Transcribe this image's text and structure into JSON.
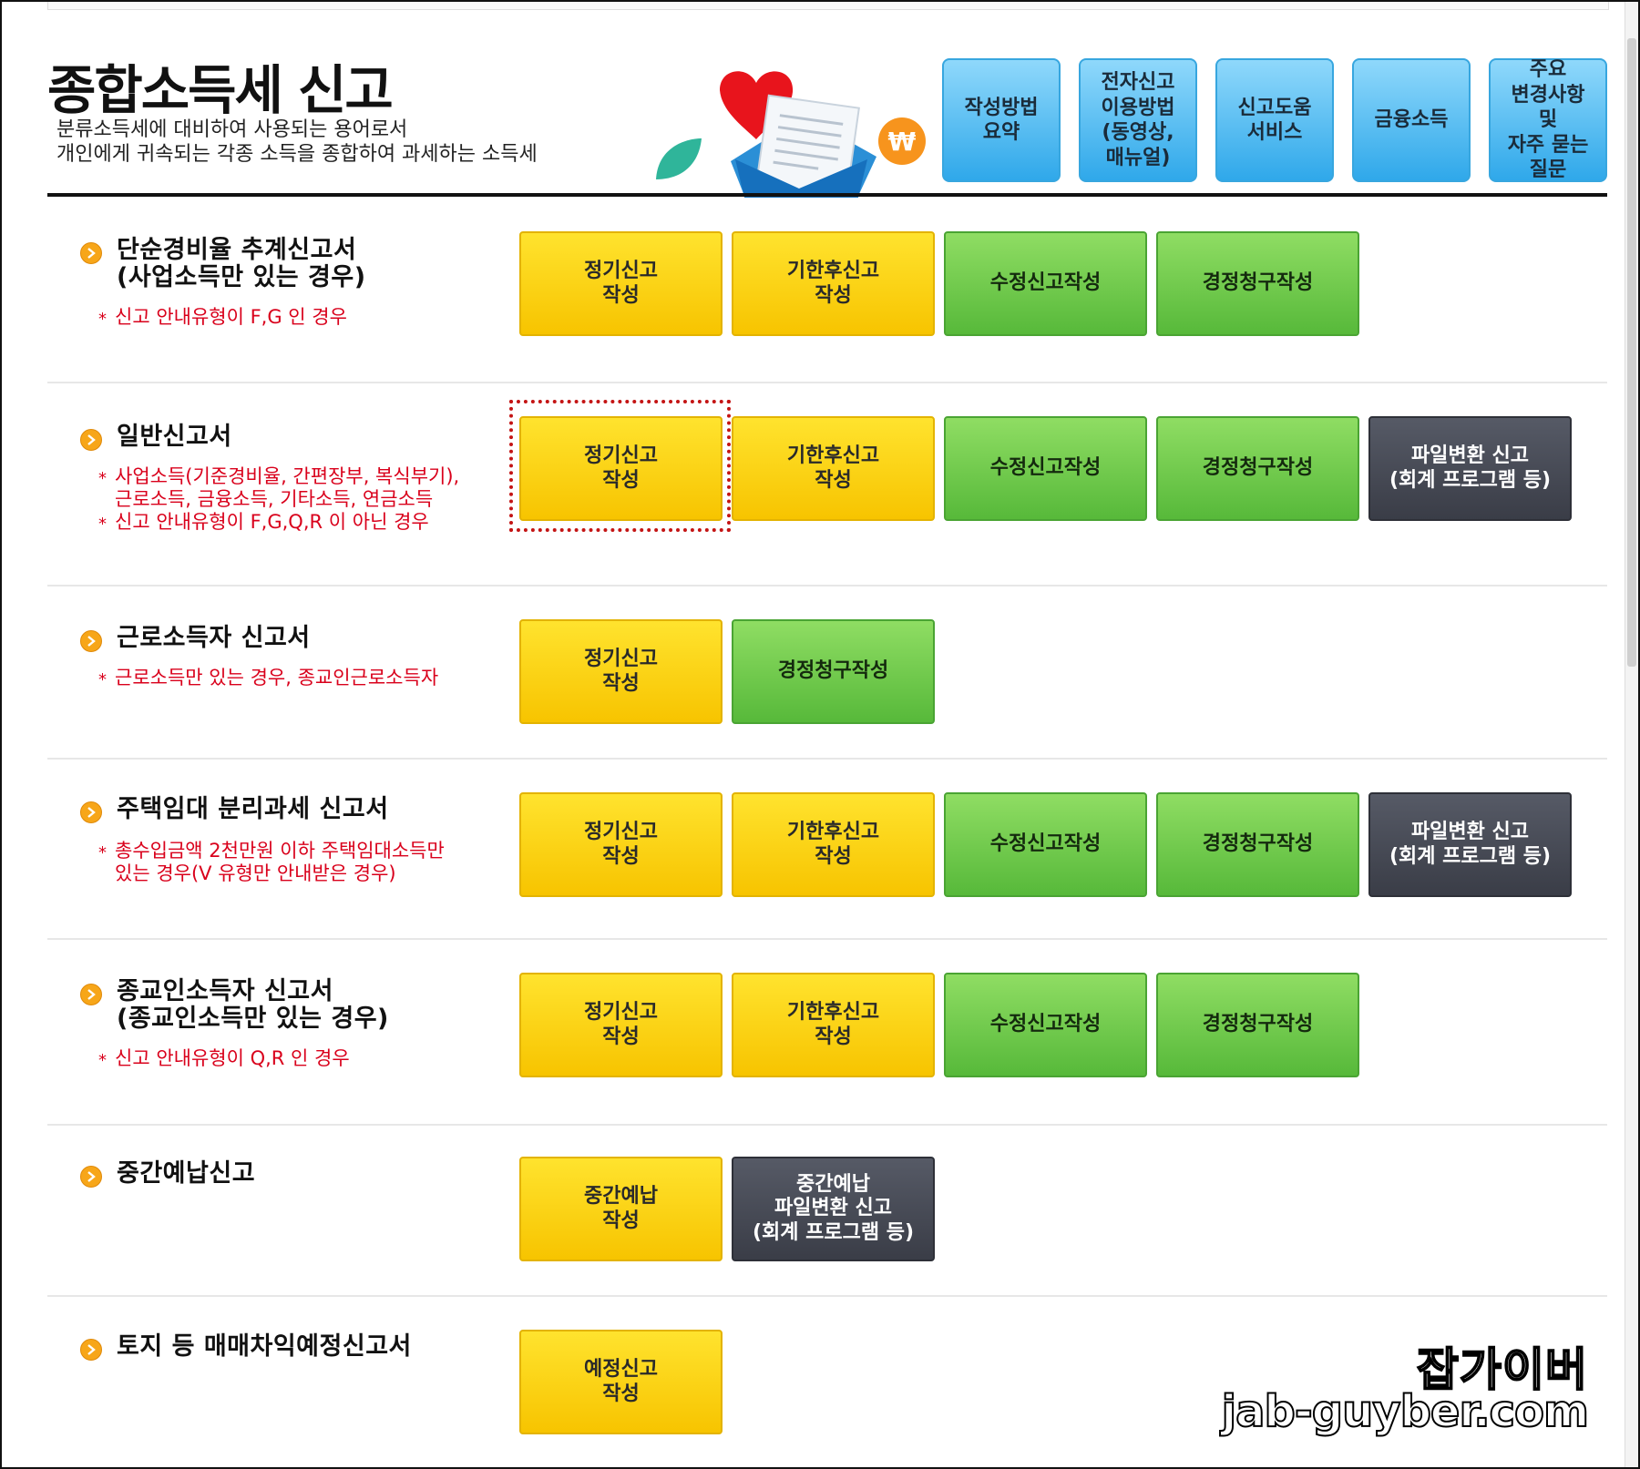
{
  "header": {
    "title": "종합소득세 신고",
    "desc_line1": "분류소득세에 대비하여 사용되는 용어로서",
    "desc_line2": "개인에게 귀속되는 각종 소득을 종합하여 과세하는 소득세"
  },
  "nav": [
    {
      "label": "작성방법\n요약"
    },
    {
      "label": "전자신고\n이용방법\n(동영상,\n매뉴얼)"
    },
    {
      "label": "신고도움\n서비스"
    },
    {
      "label": "금융소득"
    },
    {
      "label": "주요\n변경사항\n및\n자주 묻는\n질문"
    }
  ],
  "sections": [
    {
      "title": "단순경비율 추계신고서\n(사업소득만 있는 경우)",
      "notes": [
        "신고 안내유형이 F,G 인 경우"
      ],
      "buttons": [
        {
          "label": "정기신고\n작성",
          "color": "yellow"
        },
        {
          "label": "기한후신고\n작성",
          "color": "yellow"
        },
        {
          "label": "수정신고작성",
          "color": "green"
        },
        {
          "label": "경정청구작성",
          "color": "green"
        }
      ]
    },
    {
      "title": "일반신고서",
      "notes": [
        "사업소득(기준경비율, 간편장부, 복식부기),\n근로소득, 금융소득, 기타소득, 연금소득",
        "신고 안내유형이 F,G,Q,R 이 아닌 경우"
      ],
      "buttons": [
        {
          "label": "정기신고\n작성",
          "color": "yellow"
        },
        {
          "label": "기한후신고\n작성",
          "color": "yellow"
        },
        {
          "label": "수정신고작성",
          "color": "green"
        },
        {
          "label": "경정청구작성",
          "color": "green"
        },
        {
          "label": "파일변환 신고\n(회계 프로그램 등)",
          "color": "dark"
        }
      ]
    },
    {
      "title": "근로소득자 신고서",
      "notes": [
        "근로소득만 있는 경우, 종교인근로소득자"
      ],
      "buttons": [
        {
          "label": "정기신고\n작성",
          "color": "yellow"
        },
        {
          "label": "경정청구작성",
          "color": "green"
        }
      ]
    },
    {
      "title": "주택임대 분리과세 신고서",
      "notes": [
        "총수입금액 2천만원 이하 주택임대소득만\n있는 경우(V 유형만 안내받은 경우)"
      ],
      "buttons": [
        {
          "label": "정기신고\n작성",
          "color": "yellow"
        },
        {
          "label": "기한후신고\n작성",
          "color": "yellow"
        },
        {
          "label": "수정신고작성",
          "color": "green"
        },
        {
          "label": "경정청구작성",
          "color": "green"
        },
        {
          "label": "파일변환 신고\n(회계 프로그램 등)",
          "color": "dark"
        }
      ]
    },
    {
      "title": "종교인소득자 신고서\n(종교인소득만 있는 경우)",
      "notes": [
        "신고 안내유형이 Q,R 인 경우"
      ],
      "buttons": [
        {
          "label": "정기신고\n작성",
          "color": "yellow"
        },
        {
          "label": "기한후신고\n작성",
          "color": "yellow"
        },
        {
          "label": "수정신고작성",
          "color": "green"
        },
        {
          "label": "경정청구작성",
          "color": "green"
        }
      ]
    },
    {
      "title": "중간예납신고",
      "notes": [],
      "buttons": [
        {
          "label": "중간예납\n작성",
          "color": "yellow"
        },
        {
          "label": "중간예납\n파일변환 신고\n(회계 프로그램 등)",
          "color": "dark"
        }
      ]
    },
    {
      "title": "토지 등 매매차익예정신고서",
      "notes": [],
      "buttons": [
        {
          "label": "예정신고\n작성",
          "color": "yellow"
        }
      ]
    }
  ],
  "watermark": {
    "brand": "잡가이버",
    "url": "jab-guyber.com"
  },
  "colors": {
    "yellow_button": "#f7c400",
    "green_button": "#57b93a",
    "dark_button": "#3a3d47",
    "nav_button": "#2fa8ea",
    "note_text": "#d9001b",
    "bullet": "#f7a619",
    "highlight": "#c41414"
  },
  "icons": {
    "bullet": "chevron-right-icon",
    "illustration": "heart-envelope-won-icon"
  }
}
